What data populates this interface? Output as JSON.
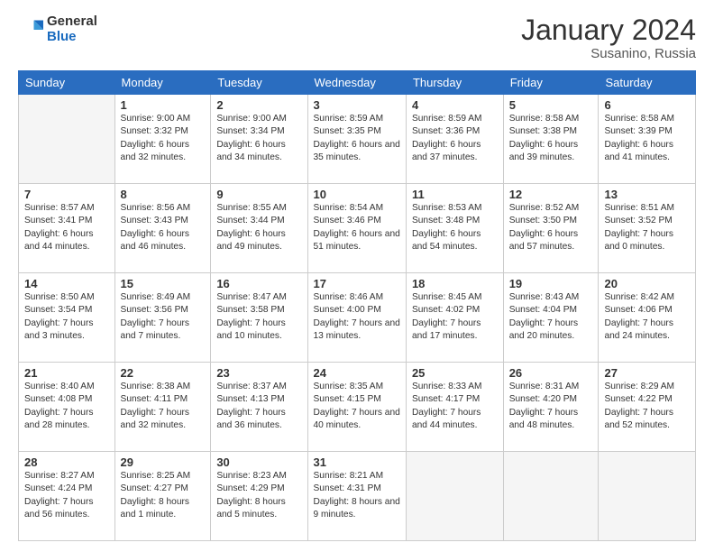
{
  "logo": {
    "general": "General",
    "blue": "Blue"
  },
  "title": "January 2024",
  "subtitle": "Susanino, Russia",
  "days_of_week": [
    "Sunday",
    "Monday",
    "Tuesday",
    "Wednesday",
    "Thursday",
    "Friday",
    "Saturday"
  ],
  "weeks": [
    [
      {
        "num": "",
        "sunrise": "",
        "sunset": "",
        "daylight": ""
      },
      {
        "num": "1",
        "sunrise": "Sunrise: 9:00 AM",
        "sunset": "Sunset: 3:32 PM",
        "daylight": "Daylight: 6 hours and 32 minutes."
      },
      {
        "num": "2",
        "sunrise": "Sunrise: 9:00 AM",
        "sunset": "Sunset: 3:34 PM",
        "daylight": "Daylight: 6 hours and 34 minutes."
      },
      {
        "num": "3",
        "sunrise": "Sunrise: 8:59 AM",
        "sunset": "Sunset: 3:35 PM",
        "daylight": "Daylight: 6 hours and 35 minutes."
      },
      {
        "num": "4",
        "sunrise": "Sunrise: 8:59 AM",
        "sunset": "Sunset: 3:36 PM",
        "daylight": "Daylight: 6 hours and 37 minutes."
      },
      {
        "num": "5",
        "sunrise": "Sunrise: 8:58 AM",
        "sunset": "Sunset: 3:38 PM",
        "daylight": "Daylight: 6 hours and 39 minutes."
      },
      {
        "num": "6",
        "sunrise": "Sunrise: 8:58 AM",
        "sunset": "Sunset: 3:39 PM",
        "daylight": "Daylight: 6 hours and 41 minutes."
      }
    ],
    [
      {
        "num": "7",
        "sunrise": "Sunrise: 8:57 AM",
        "sunset": "Sunset: 3:41 PM",
        "daylight": "Daylight: 6 hours and 44 minutes."
      },
      {
        "num": "8",
        "sunrise": "Sunrise: 8:56 AM",
        "sunset": "Sunset: 3:43 PM",
        "daylight": "Daylight: 6 hours and 46 minutes."
      },
      {
        "num": "9",
        "sunrise": "Sunrise: 8:55 AM",
        "sunset": "Sunset: 3:44 PM",
        "daylight": "Daylight: 6 hours and 49 minutes."
      },
      {
        "num": "10",
        "sunrise": "Sunrise: 8:54 AM",
        "sunset": "Sunset: 3:46 PM",
        "daylight": "Daylight: 6 hours and 51 minutes."
      },
      {
        "num": "11",
        "sunrise": "Sunrise: 8:53 AM",
        "sunset": "Sunset: 3:48 PM",
        "daylight": "Daylight: 6 hours and 54 minutes."
      },
      {
        "num": "12",
        "sunrise": "Sunrise: 8:52 AM",
        "sunset": "Sunset: 3:50 PM",
        "daylight": "Daylight: 6 hours and 57 minutes."
      },
      {
        "num": "13",
        "sunrise": "Sunrise: 8:51 AM",
        "sunset": "Sunset: 3:52 PM",
        "daylight": "Daylight: 7 hours and 0 minutes."
      }
    ],
    [
      {
        "num": "14",
        "sunrise": "Sunrise: 8:50 AM",
        "sunset": "Sunset: 3:54 PM",
        "daylight": "Daylight: 7 hours and 3 minutes."
      },
      {
        "num": "15",
        "sunrise": "Sunrise: 8:49 AM",
        "sunset": "Sunset: 3:56 PM",
        "daylight": "Daylight: 7 hours and 7 minutes."
      },
      {
        "num": "16",
        "sunrise": "Sunrise: 8:47 AM",
        "sunset": "Sunset: 3:58 PM",
        "daylight": "Daylight: 7 hours and 10 minutes."
      },
      {
        "num": "17",
        "sunrise": "Sunrise: 8:46 AM",
        "sunset": "Sunset: 4:00 PM",
        "daylight": "Daylight: 7 hours and 13 minutes."
      },
      {
        "num": "18",
        "sunrise": "Sunrise: 8:45 AM",
        "sunset": "Sunset: 4:02 PM",
        "daylight": "Daylight: 7 hours and 17 minutes."
      },
      {
        "num": "19",
        "sunrise": "Sunrise: 8:43 AM",
        "sunset": "Sunset: 4:04 PM",
        "daylight": "Daylight: 7 hours and 20 minutes."
      },
      {
        "num": "20",
        "sunrise": "Sunrise: 8:42 AM",
        "sunset": "Sunset: 4:06 PM",
        "daylight": "Daylight: 7 hours and 24 minutes."
      }
    ],
    [
      {
        "num": "21",
        "sunrise": "Sunrise: 8:40 AM",
        "sunset": "Sunset: 4:08 PM",
        "daylight": "Daylight: 7 hours and 28 minutes."
      },
      {
        "num": "22",
        "sunrise": "Sunrise: 8:38 AM",
        "sunset": "Sunset: 4:11 PM",
        "daylight": "Daylight: 7 hours and 32 minutes."
      },
      {
        "num": "23",
        "sunrise": "Sunrise: 8:37 AM",
        "sunset": "Sunset: 4:13 PM",
        "daylight": "Daylight: 7 hours and 36 minutes."
      },
      {
        "num": "24",
        "sunrise": "Sunrise: 8:35 AM",
        "sunset": "Sunset: 4:15 PM",
        "daylight": "Daylight: 7 hours and 40 minutes."
      },
      {
        "num": "25",
        "sunrise": "Sunrise: 8:33 AM",
        "sunset": "Sunset: 4:17 PM",
        "daylight": "Daylight: 7 hours and 44 minutes."
      },
      {
        "num": "26",
        "sunrise": "Sunrise: 8:31 AM",
        "sunset": "Sunset: 4:20 PM",
        "daylight": "Daylight: 7 hours and 48 minutes."
      },
      {
        "num": "27",
        "sunrise": "Sunrise: 8:29 AM",
        "sunset": "Sunset: 4:22 PM",
        "daylight": "Daylight: 7 hours and 52 minutes."
      }
    ],
    [
      {
        "num": "28",
        "sunrise": "Sunrise: 8:27 AM",
        "sunset": "Sunset: 4:24 PM",
        "daylight": "Daylight: 7 hours and 56 minutes."
      },
      {
        "num": "29",
        "sunrise": "Sunrise: 8:25 AM",
        "sunset": "Sunset: 4:27 PM",
        "daylight": "Daylight: 8 hours and 1 minute."
      },
      {
        "num": "30",
        "sunrise": "Sunrise: 8:23 AM",
        "sunset": "Sunset: 4:29 PM",
        "daylight": "Daylight: 8 hours and 5 minutes."
      },
      {
        "num": "31",
        "sunrise": "Sunrise: 8:21 AM",
        "sunset": "Sunset: 4:31 PM",
        "daylight": "Daylight: 8 hours and 9 minutes."
      },
      {
        "num": "",
        "sunrise": "",
        "sunset": "",
        "daylight": ""
      },
      {
        "num": "",
        "sunrise": "",
        "sunset": "",
        "daylight": ""
      },
      {
        "num": "",
        "sunrise": "",
        "sunset": "",
        "daylight": ""
      }
    ]
  ]
}
